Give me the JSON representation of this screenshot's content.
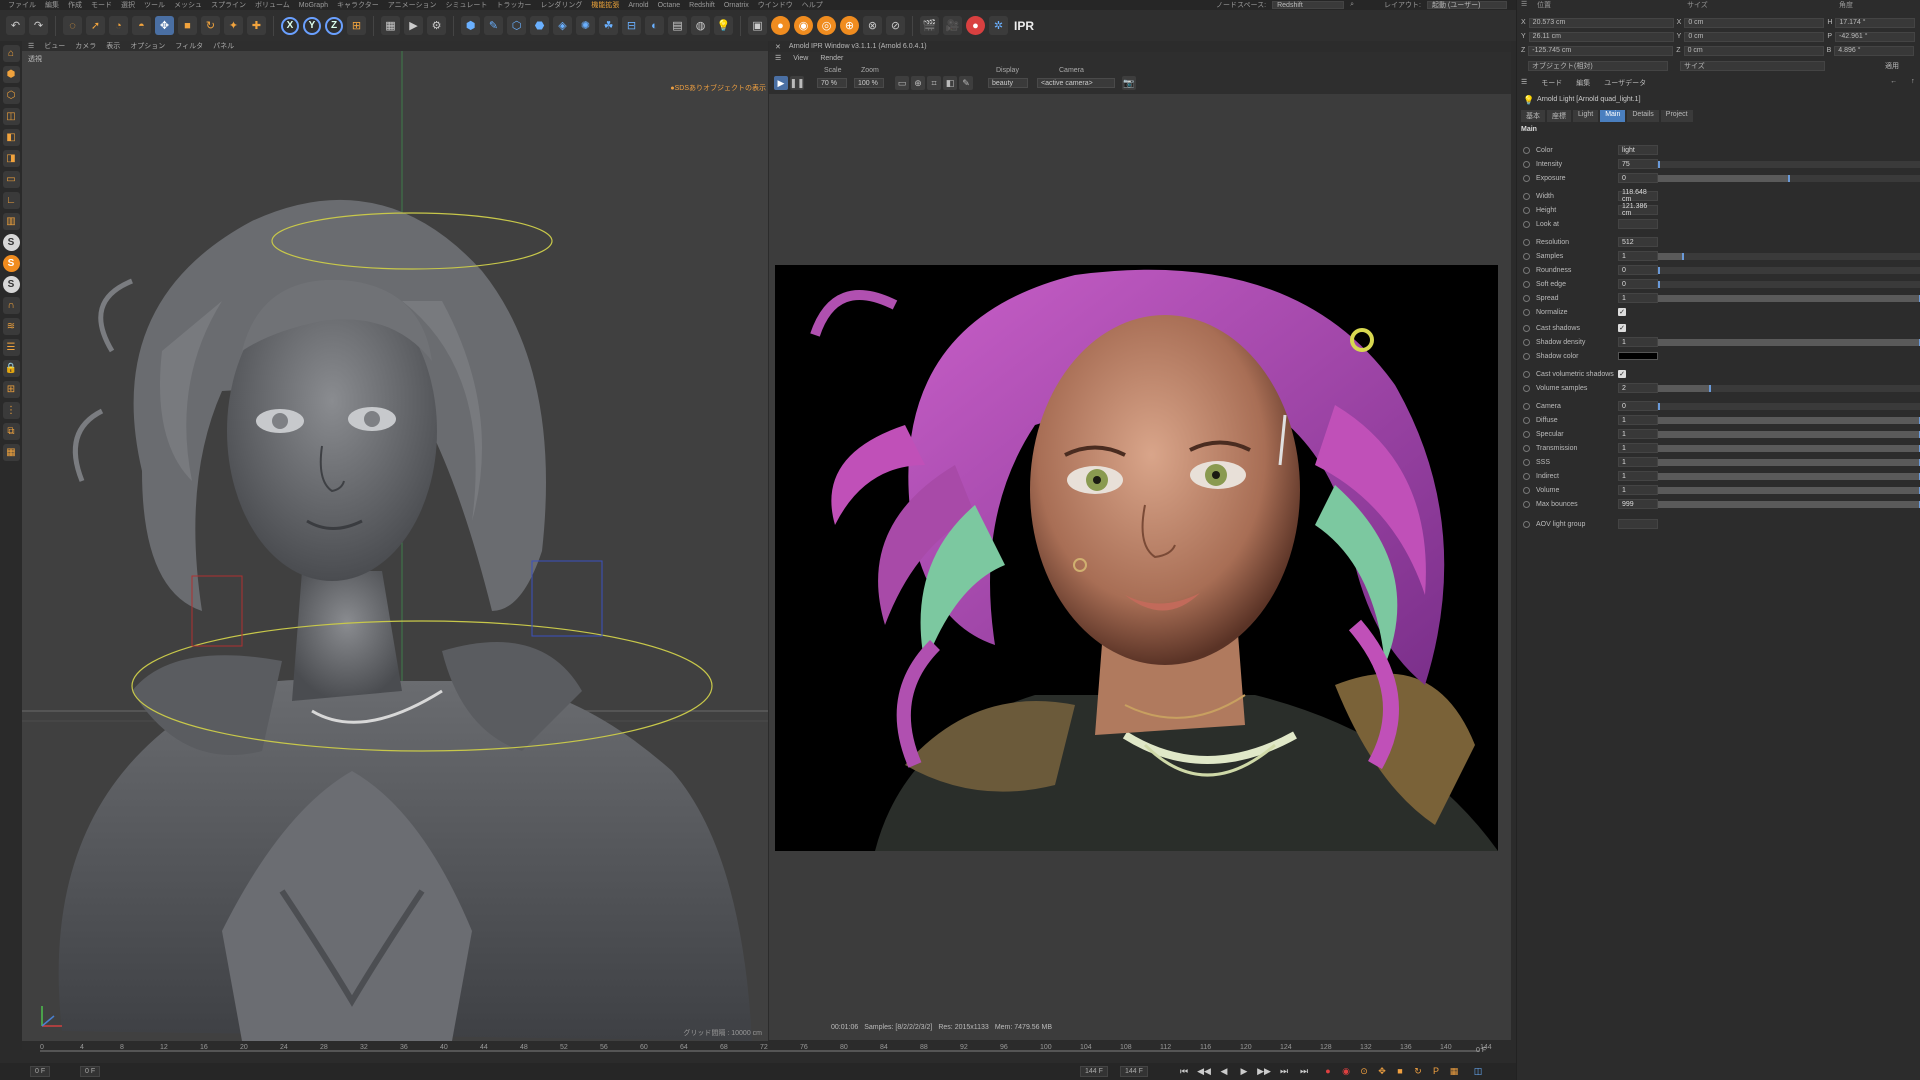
{
  "menubar": {
    "items": [
      "ファイル",
      "編集",
      "作成",
      "モード",
      "選択",
      "ツール",
      "メッシュ",
      "スプライン",
      "ボリューム",
      "MoGraph",
      "キャラクター",
      "アニメーション",
      "シミュレート",
      "トラッカー",
      "レンダリング",
      "機能拡張",
      "Arnold",
      "Octane",
      "Redshift",
      "Ornatrix",
      "ウインドウ",
      "ヘルプ"
    ],
    "highlight_index": 15,
    "nodespace_label": "ノードスペース:",
    "nodespace_value": "Redshift",
    "layout_label": "レイアウト:",
    "layout_value": "起動 (ユーザー)"
  },
  "toolbar": {
    "ipr_label": "IPR"
  },
  "viewport": {
    "menu": [
      "ビュー",
      "カメラ",
      "表示",
      "オプション",
      "フィルタ",
      "パネル"
    ],
    "label": "透視",
    "warning": "●SDSありオブジェクトの表示",
    "grid": "グリッド間隔 : 10000 cm"
  },
  "ipr": {
    "title": "Arnold IPR Window v3.1.1.1 (Arnold 6.0.4.1)",
    "menu": [
      "View",
      "Render"
    ],
    "scale_label": "Scale",
    "scale_value": "70 %",
    "zoom_label": "Zoom",
    "zoom_value": "100 %",
    "display_label": "Display",
    "display_value": "beauty",
    "camera_label": "Camera",
    "camera_value": "<active camera>",
    "status": {
      "time": "00:01:06",
      "samples": "Samples: [8/2/2/2/3/2]",
      "res": "Res: 2015x1133",
      "mem": "Mem: 7479.56 MB"
    }
  },
  "coords": {
    "headers": [
      "位置",
      "サイズ",
      "角度"
    ],
    "rows": [
      {
        "axis": "X",
        "pos": "20.573 cm",
        "size_axis": "X",
        "size": "0 cm",
        "rot_axis": "H",
        "rot": "17.174 °"
      },
      {
        "axis": "Y",
        "pos": "26.11 cm",
        "size_axis": "Y",
        "size": "0 cm",
        "rot_axis": "P",
        "rot": "-42.961 °"
      },
      {
        "axis": "Z",
        "pos": "-125.745 cm",
        "size_axis": "Z",
        "size": "0 cm",
        "rot_axis": "B",
        "rot": "4.896 °"
      }
    ],
    "mode": "オブジェクト(相対)",
    "size_mode": "サイズ",
    "apply": "適用"
  },
  "attributes": {
    "tabs": [
      "モード",
      "編集",
      "ユーザデータ"
    ],
    "object_name": "Arnold Light [Arnold quad_light.1]",
    "subtabs": [
      "基本",
      "座標",
      "Light",
      "Main",
      "Details",
      "Project"
    ],
    "active_subtab": 3,
    "section": "Main",
    "params": [
      {
        "name": "Color",
        "value": "light",
        "kind": "text"
      },
      {
        "name": "Intensity",
        "value": "75",
        "kind": "slider",
        "level": 0
      },
      {
        "name": "Exposure",
        "value": "0",
        "kind": "slider",
        "level": 0.5
      },
      {
        "name": "Width",
        "value": "118.648 cm",
        "kind": "value"
      },
      {
        "name": "Height",
        "value": "121.386 cm",
        "kind": "value"
      },
      {
        "name": "Look at",
        "value": "",
        "kind": "value"
      },
      {
        "name": "Resolution",
        "value": "512",
        "kind": "value"
      },
      {
        "name": "Samples",
        "value": "1",
        "kind": "slider",
        "level": 0.1
      },
      {
        "name": "Roundness",
        "value": "0",
        "kind": "slider",
        "level": 0
      },
      {
        "name": "Soft edge",
        "value": "0",
        "kind": "slider",
        "level": 0
      },
      {
        "name": "Spread",
        "value": "1",
        "kind": "slider",
        "level": 1
      },
      {
        "name": "Normalize",
        "value": "✓",
        "kind": "check"
      },
      {
        "name": "Cast shadows",
        "value": "✓",
        "kind": "check"
      },
      {
        "name": "Shadow density",
        "value": "1",
        "kind": "slider",
        "level": 1
      },
      {
        "name": "Shadow color",
        "value": "",
        "kind": "swatch"
      },
      {
        "name": "Cast volumetric shadows",
        "value": "✓",
        "kind": "check"
      },
      {
        "name": "Volume samples",
        "value": "2",
        "kind": "slider",
        "level": 0.2
      },
      {
        "name": "Camera",
        "value": "0",
        "kind": "slider",
        "level": 0
      },
      {
        "name": "Diffuse",
        "value": "1",
        "kind": "slider",
        "level": 1
      },
      {
        "name": "Specular",
        "value": "1",
        "kind": "slider",
        "level": 1
      },
      {
        "name": "Transmission",
        "value": "1",
        "kind": "slider",
        "level": 1
      },
      {
        "name": "SSS",
        "value": "1",
        "kind": "slider",
        "level": 1
      },
      {
        "name": "Indirect",
        "value": "1",
        "kind": "slider",
        "level": 1
      },
      {
        "name": "Volume",
        "value": "1",
        "kind": "slider",
        "level": 1
      },
      {
        "name": "Max bounces",
        "value": "999",
        "kind": "slider",
        "level": 1
      },
      {
        "name": "AOV light group",
        "value": "",
        "kind": "value"
      }
    ]
  },
  "timeline": {
    "ticks": [
      "0",
      "4",
      "8",
      "12",
      "16",
      "20",
      "24",
      "28",
      "32",
      "36",
      "40",
      "44",
      "48",
      "52",
      "56",
      "60",
      "64",
      "68",
      "72",
      "76",
      "80",
      "84",
      "88",
      "92",
      "96",
      "100",
      "104",
      "108",
      "112",
      "116",
      "120",
      "124",
      "128",
      "132",
      "136",
      "140",
      "144"
    ],
    "current": "0 F",
    "start": "0 F",
    "min": "0 F",
    "end": "144 F",
    "max": "144 F"
  },
  "colors": {
    "accent": "#4a7fbf",
    "orange": "#f08c1f"
  }
}
